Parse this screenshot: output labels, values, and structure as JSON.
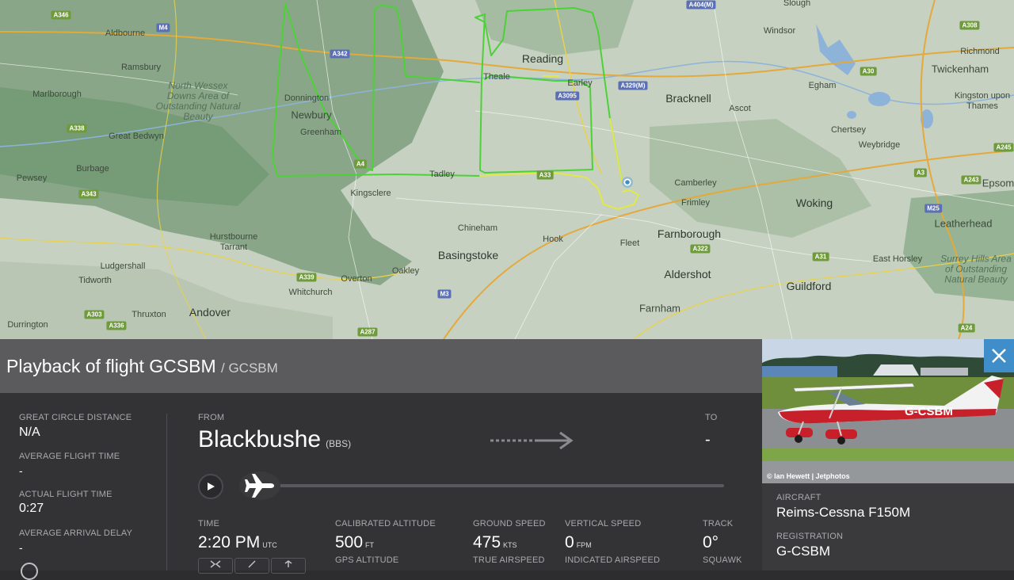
{
  "map": {
    "towns": [
      {
        "id": "reading",
        "label": "Reading"
      },
      {
        "id": "bracknell",
        "label": "Bracknell"
      },
      {
        "id": "basingstoke",
        "label": "Basingstoke"
      },
      {
        "id": "farnborough",
        "label": "Farnborough"
      },
      {
        "id": "aldershot",
        "label": "Aldershot"
      },
      {
        "id": "woking",
        "label": "Woking"
      },
      {
        "id": "guildford",
        "label": "Guildford"
      },
      {
        "id": "andover",
        "label": "Andover"
      },
      {
        "id": "newbury",
        "label": "Newbury"
      },
      {
        "id": "twickenham",
        "label": "Twickenham"
      },
      {
        "id": "farnham",
        "label": "Farnham"
      },
      {
        "id": "leatherhead",
        "label": "Leatherhead"
      }
    ],
    "places": [
      "Aldbourne",
      "Ramsbury",
      "Marlborough",
      "Great Bedwyn",
      "Burbage",
      "Pewsey",
      "Ludgershall",
      "Tidworth",
      "Durrington",
      "Thruxton",
      "Donnington",
      "Greenham",
      "Kingsclere",
      "Tadley",
      "Whitchurch",
      "Overton",
      "Oakley",
      "Chineham",
      "Hook",
      "Fleet",
      "Camberley",
      "Frimley",
      "Earley",
      "Theale",
      "Ascot",
      "Egham",
      "Windsor",
      "Chertsey",
      "Weybridge",
      "Richmond",
      "Kingston upon Thames",
      "East Horsley",
      "Epsom",
      "Hurstbourne Tarrant",
      "Slough"
    ],
    "areas": [
      "North Wessex Downs Area of Outstanding Natural Beauty",
      "Surrey Hills Area of Outstanding Natural Beauty"
    ],
    "roads": [
      "A346",
      "M4",
      "A338",
      "A4",
      "A343",
      "A303",
      "A339",
      "M3",
      "A33",
      "A329(M)",
      "A322",
      "A31",
      "A3",
      "A30",
      "M25",
      "A243",
      "A24",
      "A308",
      "A245",
      "A404(M)",
      "A336",
      "A287",
      "A342",
      "A3095"
    ]
  },
  "header": {
    "title": "Playback of flight GCSBM",
    "subtitle": "/ GCSBM"
  },
  "stats": {
    "great_circle_distance": {
      "label": "GREAT CIRCLE DISTANCE",
      "value": "N/A"
    },
    "average_flight_time": {
      "label": "AVERAGE FLIGHT TIME",
      "value": "-"
    },
    "actual_flight_time": {
      "label": "ACTUAL FLIGHT TIME",
      "value": "0:27"
    },
    "average_arrival_delay": {
      "label": "AVERAGE ARRIVAL DELAY",
      "value": "-"
    }
  },
  "route": {
    "from_label": "FROM",
    "from_name": "Blackbushe",
    "from_code": "(BBS)",
    "to_label": "TO",
    "to_value": "-"
  },
  "telemetry": {
    "time": {
      "label": "TIME",
      "value": "2:20 PM",
      "unit": "UTC"
    },
    "calibrated_altitude": {
      "label": "CALIBRATED ALTITUDE",
      "value": "500",
      "unit": "FT"
    },
    "gps_altitude": {
      "label": "GPS ALTITUDE"
    },
    "ground_speed": {
      "label": "GROUND SPEED",
      "value": "475",
      "unit": "KTS"
    },
    "true_airspeed": {
      "label": "TRUE AIRSPEED"
    },
    "vertical_speed": {
      "label": "VERTICAL SPEED",
      "value": "0",
      "unit": "FPM"
    },
    "indicated_airspeed": {
      "label": "INDICATED AIRSPEED"
    },
    "track": {
      "label": "TRACK",
      "value": "0°"
    },
    "squawk": {
      "label": "SQUAWK"
    }
  },
  "aircraft": {
    "photo_credit": "© Ian Hewett | Jetphotos",
    "photo_registration_text": "G-CSBM",
    "aircraft_label": "AIRCRAFT",
    "aircraft_value": "Reims-Cessna F150M",
    "registration_label": "REGISTRATION",
    "registration_value": "G-CSBM"
  },
  "colors": {
    "track_green": "#4cd137",
    "track_yellow": "#e1e84a",
    "header_bg": "#5b5b5e",
    "panel_bg": "#333336",
    "close_blue": "#3f8ec9"
  }
}
